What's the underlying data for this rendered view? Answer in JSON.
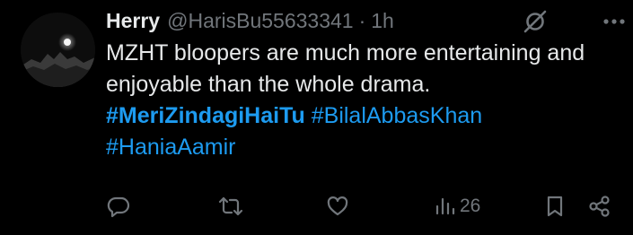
{
  "post": {
    "author": {
      "display_name": "Herry",
      "handle": "@HarisBu55633341",
      "separator": "·",
      "time": "1h"
    },
    "text": "MZHT bloopers are much more entertaining and enjoyable than the whole drama.",
    "hashtags": [
      "#MeriZindagiHaiTu",
      "#BilalAbbasKhan",
      "#HaniaAamir"
    ],
    "stats": {
      "views": "26"
    }
  },
  "icons": {
    "header": [
      "grok-icon",
      "more-icon"
    ],
    "actions": [
      "reply-icon",
      "repost-icon",
      "like-icon",
      "views-icon",
      "bookmark-icon",
      "share-icon"
    ]
  },
  "colors": {
    "background": "#000000",
    "text": "#e7e9ea",
    "secondary": "#71767b",
    "link": "#1d9bf0"
  }
}
